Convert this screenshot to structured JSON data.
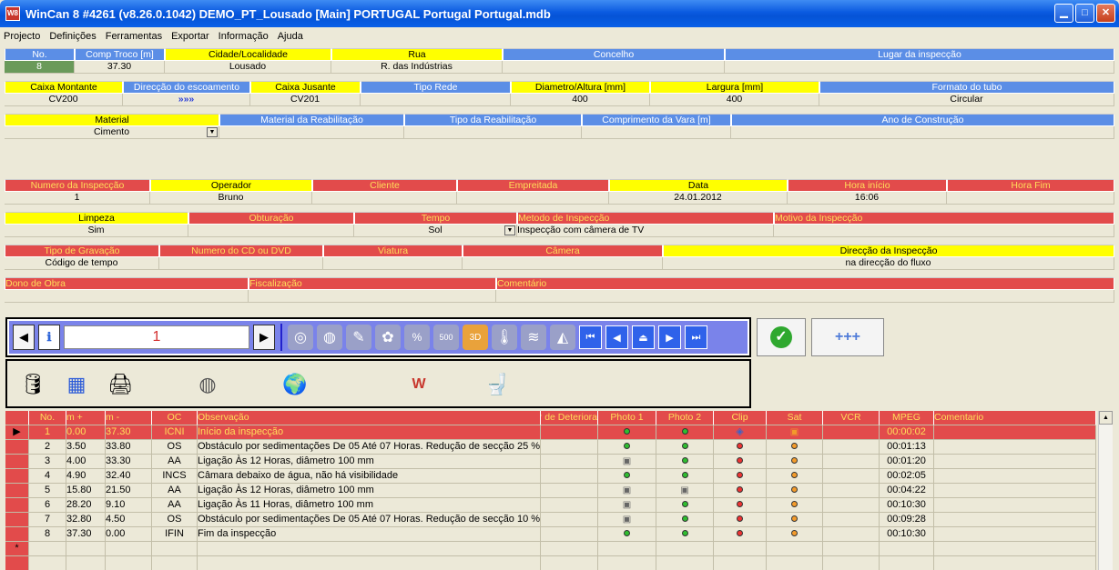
{
  "window": {
    "title": "WinCan 8 #4261  (v8.26.0.1042) DEMO_PT_Lousado [Main]  PORTUGAL  Portugal  Portugal.mdb",
    "icon": "wincan-icon"
  },
  "menu": [
    "Projecto",
    "Definições",
    "Ferramentas",
    "Exportar",
    "Informação",
    "Ajuda"
  ],
  "row1": {
    "headers": [
      "No.",
      "Comp Troco [m]",
      "Cidade/Localidade",
      "Rua",
      "Concelho",
      "Lugar da inspecção"
    ],
    "values": [
      "8",
      "37.30",
      "Lousado",
      "R. das Indústrias",
      "",
      ""
    ]
  },
  "row2": {
    "headers": [
      "Caixa Montante",
      "Direcção do escoamento",
      "Caixa Jusante",
      "Tipo Rede",
      "Diametro/Altura [mm]",
      "Largura [mm]",
      "Formato do tubo"
    ],
    "values": [
      "CV200",
      "»»»",
      "CV201",
      "",
      "400",
      "400",
      "Circular"
    ]
  },
  "row3": {
    "headers": [
      "Material",
      "Material da Reabilitação",
      "Tipo da Reabilitação",
      "Comprimento da Vara [m]",
      "Ano de Construção"
    ],
    "values": [
      "Cimento",
      "",
      "",
      "",
      ""
    ]
  },
  "row4": {
    "headers": [
      "Numero da Inspecção",
      "Operador",
      "Cliente",
      "Empreitada",
      "Data",
      "Hora início",
      "Hora Fim"
    ],
    "values": [
      "1",
      "Bruno",
      "",
      "",
      "24.01.2012",
      "16:06",
      ""
    ]
  },
  "row5": {
    "headers": [
      "Limpeza",
      "Obturação",
      "Tempo",
      "Metodo de Inspecção",
      "Motivo da Inspecção"
    ],
    "values": [
      "Sim",
      "",
      "Sol",
      "Inspecção com câmera de TV",
      ""
    ]
  },
  "row6": {
    "headers": [
      "Tipo de Gravação",
      "Numero do CD ou DVD",
      "Viatura",
      "Câmera",
      "Direcção da Inspecção"
    ],
    "values": [
      "Código de tempo",
      "",
      "",
      "",
      "na direcção do fluxo"
    ]
  },
  "row7": {
    "headers": [
      "Dono de Obra",
      "Fiscalização",
      "Comentário"
    ],
    "values": [
      "",
      "",
      ""
    ]
  },
  "toolbar": {
    "counter": "1"
  },
  "grid": {
    "headers": [
      "No.",
      "m +",
      "m -",
      "OC",
      "Observação",
      "r de Deteriora",
      "Photo 1",
      "Photo 2",
      "Clip",
      "Sat",
      "VCR",
      "MPEG",
      "Comentario"
    ],
    "rows": [
      {
        "no": "1",
        "mp": "0.00",
        "mm": "37.30",
        "oc": "ICNI",
        "obs": "Início da inspecção",
        "p1": "g",
        "p2": "g",
        "clip": "clip",
        "sat": "sat",
        "mpeg": "00:00:02",
        "selected": true
      },
      {
        "no": "2",
        "mp": "3.50",
        "mm": "33.80",
        "oc": "OS",
        "obs": "Obstáculo por sedimentações De 05 Até 07 Horas. Redução de secção 25 %",
        "p1": "g",
        "p2": "g",
        "clip": "r",
        "sat": "o",
        "mpeg": "00:01:13"
      },
      {
        "no": "3",
        "mp": "4.00",
        "mm": "33.30",
        "oc": "AA",
        "obs": "Ligação Às 12 Horas, diâmetro 100 mm",
        "p1": "cam",
        "p2": "g",
        "clip": "r",
        "sat": "o",
        "mpeg": "00:01:20"
      },
      {
        "no": "4",
        "mp": "4.90",
        "mm": "32.40",
        "oc": "INCS",
        "obs": "Câmara debaixo de água, não há visibilidade",
        "p1": "g",
        "p2": "g",
        "clip": "r",
        "sat": "o",
        "mpeg": "00:02:05"
      },
      {
        "no": "5",
        "mp": "15.80",
        "mm": "21.50",
        "oc": "AA",
        "obs": "Ligação Às 12 Horas, diâmetro 100 mm",
        "p1": "cam",
        "p2": "cam",
        "clip": "r",
        "sat": "o",
        "mpeg": "00:04:22"
      },
      {
        "no": "6",
        "mp": "28.20",
        "mm": "9.10",
        "oc": "AA",
        "obs": "Ligação Às 11 Horas, diâmetro 100 mm",
        "p1": "cam",
        "p2": "g",
        "clip": "r",
        "sat": "o",
        "mpeg": "00:10:30"
      },
      {
        "no": "7",
        "mp": "32.80",
        "mm": "4.50",
        "oc": "OS",
        "obs": "Obstáculo por sedimentações De 05 Até 07 Horas. Redução de secção 10 %",
        "p1": "cam",
        "p2": "g",
        "clip": "r",
        "sat": "o",
        "mpeg": "00:09:28"
      },
      {
        "no": "8",
        "mp": "37.30",
        "mm": "0.00",
        "oc": "IFIN",
        "obs": "Fim da inspecção",
        "p1": "g",
        "p2": "g",
        "clip": "r",
        "sat": "o",
        "mpeg": "00:10:30"
      }
    ],
    "new_row_marker": "*"
  }
}
